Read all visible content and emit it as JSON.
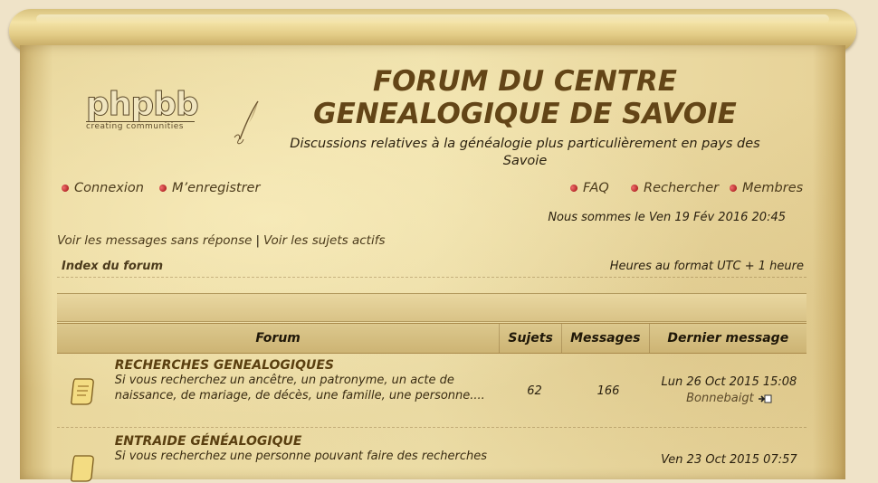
{
  "logo": {
    "word": "phpbb",
    "tagline": "creating communities"
  },
  "site": {
    "title_line1": "FORUM DU CENTRE",
    "title_line2": "GENEALOGIQUE DE SAVOIE",
    "description": "Discussions relatives à la généalogie plus particulièrement en pays des Savoie"
  },
  "nav": {
    "login": "Connexion",
    "register": "M’enregistrer",
    "faq": "FAQ",
    "search": "Rechercher",
    "members": "Membres"
  },
  "date_text": "Nous sommes le Ven 19 Fév 2016 20:45",
  "quick_links": {
    "unanswered": "Voir les messages sans réponse",
    "separator": "|",
    "active": "Voir les sujets actifs"
  },
  "breadcrumb": "Index du forum",
  "timezone": "Heures au format UTC + 1 heure",
  "table": {
    "headers": {
      "forum": "Forum",
      "topics": "Sujets",
      "posts": "Messages",
      "last": "Dernier message"
    },
    "rows": [
      {
        "title": "RECHERCHES GENEALOGIQUES",
        "desc": "Si vous recherchez un ancêtre, un patronyme, un acte de naissance, de mariage, de décès, une famille, une personne....",
        "topics": "62",
        "posts": "166",
        "last_date": "Lun 26 Oct 2015 15:08",
        "last_author": "Bonnebaigt"
      },
      {
        "title": "ENTRAIDE GÉNÉALOGIQUE",
        "desc": "Si vous recherchez une personne pouvant faire des recherches",
        "topics": "",
        "posts": "",
        "last_date": "Ven 23 Oct 2015 07:57",
        "last_author": ""
      }
    ]
  },
  "colors": {
    "title": "#634517",
    "parchment": "#f0e2ad",
    "link": "#4c3b1c",
    "bullet": "#9b0d0d"
  }
}
